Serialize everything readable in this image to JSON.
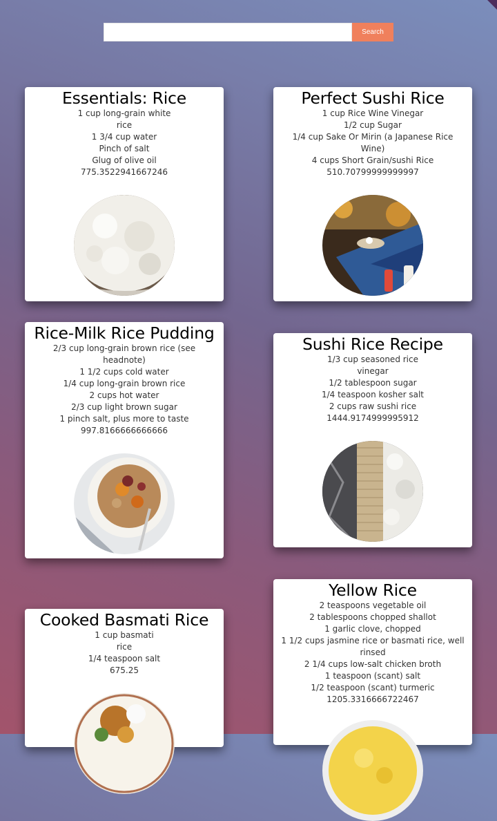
{
  "search": {
    "placeholder": "",
    "value": "",
    "button_label": "Search"
  },
  "recipes": [
    {
      "title": "Essentials: Rice",
      "ingredients": [
        "1 cup long-grain white rice",
        "1 3/4 cup water",
        "Pinch of salt",
        "Glug of olive oil"
      ],
      "calories": "775.3522941667246",
      "image": "white-rice-photo"
    },
    {
      "title": "Perfect Sushi Rice",
      "ingredients": [
        "1 cup Rice Wine Vinegar",
        "1/2 cup Sugar",
        "1/4 cup Sake Or Mirin (a Japanese Rice Wine)",
        "4 cups Short Grain/sushi Rice"
      ],
      "calories": "510.70799999999997",
      "image": "sushi-prep-photo"
    },
    {
      "title": "Rice-Milk Rice Pudding",
      "ingredients": [
        "2/3 cup long-grain brown rice (see headnote)",
        "1 1/2 cups cold water",
        "1/4 cup long-grain brown rice",
        "2 cups hot water",
        "2/3 cup light brown sugar",
        "1 pinch salt, plus more to taste"
      ],
      "calories": "997.8166666666666",
      "image": "rice-pudding-photo"
    },
    {
      "title": "Sushi Rice Recipe",
      "ingredients": [
        "1/3 cup seasoned rice vinegar",
        "1/2 tablespoon sugar",
        "1/4 teaspoon kosher salt",
        "2 cups raw sushi rice"
      ],
      "calories": "1444.9174999995912",
      "image": "sushi-mat-photo"
    },
    {
      "title": "Cooked Basmati Rice",
      "ingredients": [
        "1 cup basmati rice",
        "1/4 teaspoon salt"
      ],
      "calories": "675.25",
      "image": "basmati-dish-photo"
    },
    {
      "title": "Yellow Rice",
      "ingredients": [
        "2 teaspoons vegetable oil",
        "2 tablespoons chopped shallot",
        "1 garlic clove, chopped",
        "1 1/2 cups jasmine rice or basmati rice, well rinsed",
        "2 1/4 cups low-salt chicken broth",
        "1 teaspoon (scant) salt",
        "1/2 teaspoon (scant) turmeric"
      ],
      "calories": "1205.3316666722467",
      "image": "yellow-rice-photo"
    }
  ]
}
